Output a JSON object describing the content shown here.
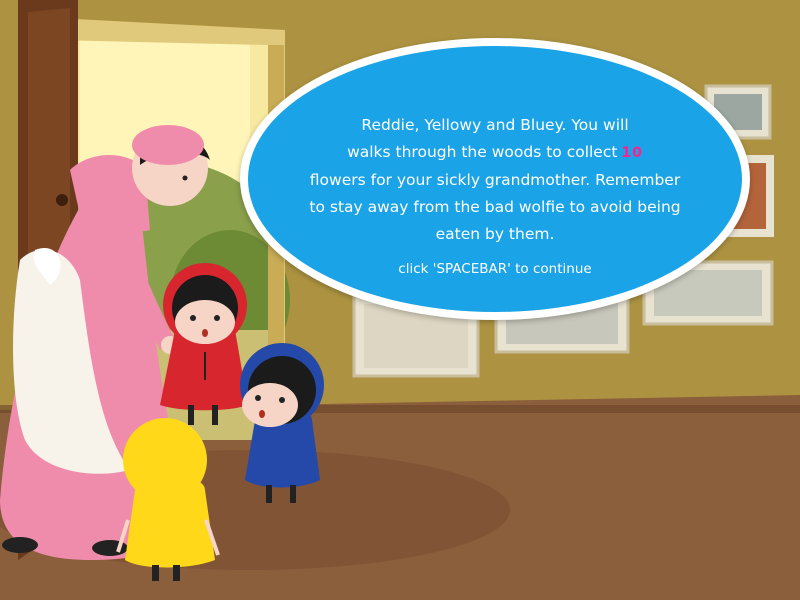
{
  "dialog": {
    "line1": "Reddie, Yellowy and Bluey. You will",
    "line2": "walks through the woods to collect",
    "flower_count": "10",
    "line3": "flowers for your sickly grandmother. Remember",
    "line4": "to stay away from the bad wolfie to avoid being",
    "line5": "eaten by them.",
    "continue_prompt": "click 'SPACEBAR' to continue"
  },
  "characters": [
    "grandma-caretaker",
    "reddie",
    "bluey",
    "yellowy"
  ],
  "colors": {
    "wall": "#a98e3e",
    "floor": "#8b5e3c",
    "speech_bubble": "#1aa3e6",
    "flower_count": "#ff1f8f",
    "reddie": "#d8262e",
    "bluey": "#2449a8",
    "yellowy": "#ffd81a",
    "dress": "#f08cab"
  }
}
